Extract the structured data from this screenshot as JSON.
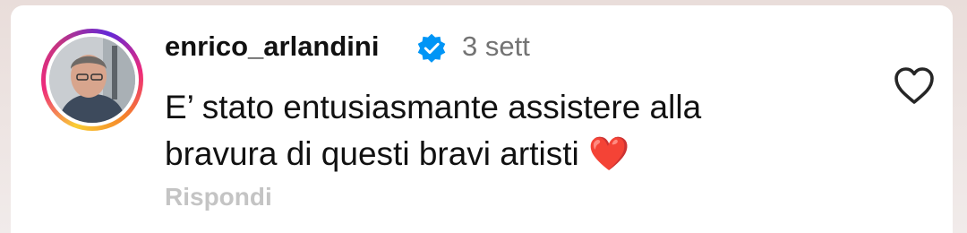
{
  "comment": {
    "username": "enrico_arlandini",
    "verified": true,
    "timestamp": "3 sett",
    "text_line1": "E’ stato entusiasmante assistere alla",
    "text_line2": "bravura di questi bravi artisti",
    "emoji": "❤️",
    "reply_label": "Rispondi"
  },
  "icons": {
    "verified": "verified-badge-icon",
    "like": "heart-outline-icon"
  },
  "colors": {
    "verified_blue": "#0095f6",
    "secondary_text": "#737373",
    "reply_text": "#c4c4c4"
  }
}
